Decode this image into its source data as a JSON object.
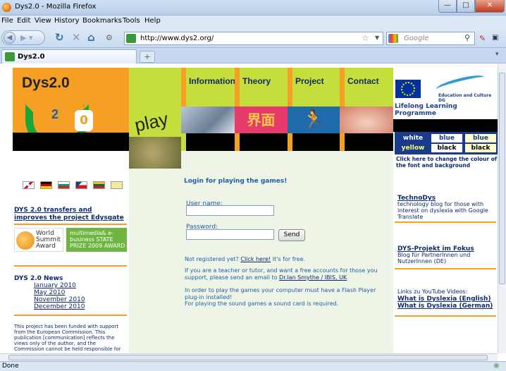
{
  "window": {
    "title": "Dys2.0 - Mozilla Firefox"
  },
  "menu": [
    "File",
    "Edit",
    "View",
    "History",
    "Bookmarks",
    "Tools",
    "Help"
  ],
  "address": {
    "url": "http://www.dys2.org/"
  },
  "search": {
    "placeholder": "Google"
  },
  "tab": {
    "label": "Dys2.0",
    "new_tab": "+"
  },
  "status": {
    "text": "Done"
  },
  "header": {
    "logo_title": "Dys2.0",
    "logo_2": "2",
    "logo_0": "0",
    "play": "play",
    "nav": [
      "Information",
      "Theory",
      "Project",
      "Contact"
    ],
    "eu": {
      "dg": "Education and Culture DG",
      "llp": "Lifelong Learning Programme"
    }
  },
  "colour_switch": {
    "items": [
      {
        "label": "white",
        "bg": "#1a3a8c",
        "fg": "#ffffff"
      },
      {
        "label": "blue",
        "bg": "#ffffff",
        "fg": "#1a3a8c"
      },
      {
        "label": "blue",
        "bg": "#ffffcc",
        "fg": "#1a3a8c"
      },
      {
        "label": "yellow",
        "bg": "#1a3a8c",
        "fg": "#ffff66"
      },
      {
        "label": "black",
        "bg": "#ffffff",
        "fg": "#000000"
      },
      {
        "label": "black",
        "bg": "#ffffcc",
        "fg": "#000000"
      }
    ],
    "note": "Click here to change the colour of the font and background"
  },
  "left": {
    "link": "DYS 2.0 transfers and improves the project Edysgate",
    "award_wsa": "World Summit Award",
    "award_mm": "multimedia& e-business STATE PRIZE 2009 AWARD",
    "news_title": "DYS 2.0 News",
    "news": [
      "January 2010",
      "May 2010",
      "November 2010",
      "December 2010"
    ],
    "funding": "This project has been funded with support from the European Commission. This publication [communication] reflects the views only of the author, and the Commission cannot be held responsible for"
  },
  "center": {
    "login_title": "Login for playing the games!",
    "username_label": "User name:",
    "password_label": "Password:",
    "send": "Send",
    "not_registered_pre": "Not registered yet?",
    "click_here": "Click here!",
    "not_registered_post": "It's for free.",
    "teacher_text": "If you are a teacher or tutor, and want a free accounts for those you support, please send an email to",
    "teacher_link": "Dr.Ian Smythe / IBIS, UK",
    "flash_text": "In order to play the games your computer must have a Flash Player plug-in installed!",
    "sound_text": "For playing the sound games a sound card is required."
  },
  "right": {
    "technodys_title": "TechnoDys",
    "technodys_text": "technology blog for those with interest on dyslexia with Google Translate",
    "fokus_title": "DYS-Projekt im Fokus",
    "fokus_text": "Blog für PartnerInnen und NutzerInnen (DE)",
    "yt_intro": "Links zu YouTube Videos:",
    "yt1": "What is Dyslexia (English)",
    "yt2": "What is Dyslexia (German)"
  },
  "colors": {
    "orange": "#f5a024",
    "lime": "#c6de3c",
    "green": "#18a838",
    "navy": "#0f2a6a",
    "blue": "#1e5fa8"
  }
}
